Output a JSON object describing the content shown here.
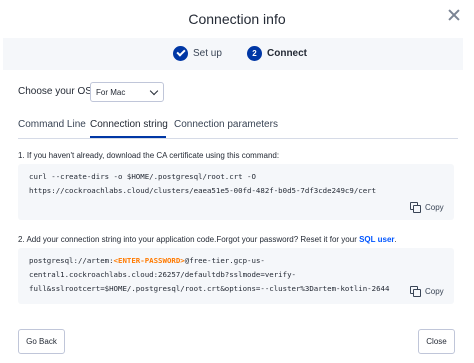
{
  "dialog": {
    "title": "Connection info"
  },
  "stepper": {
    "steps": [
      {
        "label": "Set up",
        "state": "complete"
      },
      {
        "number": "2",
        "label": "Connect",
        "state": "active"
      }
    ]
  },
  "os": {
    "label": "Choose your OS",
    "selected": "For Mac"
  },
  "tabs": [
    {
      "label": "Command Line",
      "active": false
    },
    {
      "label": "Connection string",
      "active": true
    },
    {
      "label": "Connection parameters",
      "active": false
    }
  ],
  "step1": {
    "text": "1. If you haven't already, download the CA certificate using this command:",
    "code": [
      "curl --create-dirs -o $HOME/.postgresql/root.crt -O",
      "https://cockroachlabs.cloud/clusters/eaea51e5-00fd-482f-b0d5-7df3cde249c9/cert"
    ],
    "copy_label": "Copy"
  },
  "step2": {
    "text_prefix": "2. Add your connection string into your application code.Forgot your password? Reset it for your ",
    "link_text": "SQL user",
    "text_suffix": ".",
    "code_line1_prefix": "postgresql://artem:",
    "code_password_placeholder": "<ENTER-PASSWORD>",
    "code_line1_suffix": "@free-tier.gcp-us-",
    "code_line2": "central1.cockroachlabs.cloud:26257/defaultdb?sslmode=verify-",
    "code_line3": "full&sslrootcert=$HOME/.postgresql/root.crt&options=--cluster%3Dartem-kotlin-2644",
    "copy_label": "Copy"
  },
  "footer": {
    "back_label": "Go Back",
    "close_label": "Close"
  },
  "colors": {
    "accent": "#0037a5",
    "link": "#0055ff",
    "placeholder_highlight": "#ff7a00",
    "code_background": "#f5f7fa"
  }
}
